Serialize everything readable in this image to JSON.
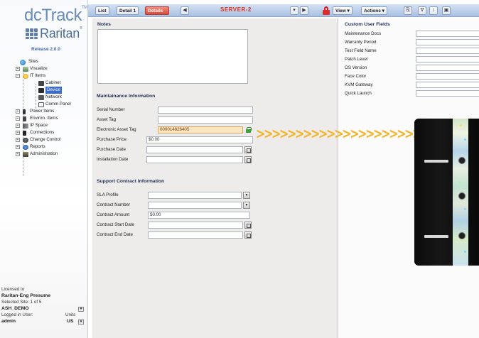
{
  "sidebar": {
    "brand": "dcTrack",
    "brand_mark": "TM",
    "vendor": "Raritan",
    "vendor_mark": "®",
    "release": "Release 2.0.0",
    "tree": [
      {
        "label": "Sites",
        "icon": "globe-icon"
      },
      {
        "label": "Visualize",
        "icon": "visualize-icon"
      },
      {
        "label": "IT Items",
        "icon": "it-items-icon"
      },
      {
        "label": "Cabinet",
        "icon": "cabinet-icon"
      },
      {
        "label": "Device",
        "icon": "device-icon"
      },
      {
        "label": "Network",
        "icon": "network-icon"
      },
      {
        "label": "Comm Panel",
        "icon": "comm-panel-icon"
      },
      {
        "label": "Power Items",
        "icon": "power-icon"
      },
      {
        "label": "Environ. Items",
        "icon": "environ-icon"
      },
      {
        "label": "IP Space",
        "icon": "ip-space-icon"
      },
      {
        "label": "Connections",
        "icon": "connections-icon"
      },
      {
        "label": "Change Control",
        "icon": "change-control-icon"
      },
      {
        "label": "Reports",
        "icon": "reports-icon"
      },
      {
        "label": "Administration",
        "icon": "administration-icon"
      }
    ],
    "status": {
      "licensed_label": "Licensed to",
      "licensee": "Raritan-Eng Presume",
      "selected_site": "Selected Site: 1 of 5",
      "site_name": "ASH_DEMO",
      "logged_in_label": "Logged in User:",
      "units_label": "Units",
      "user": "admin",
      "units": "US"
    }
  },
  "toolbar": {
    "list_label": "List",
    "detail_label": "Detail 1",
    "active_label": "Details",
    "title": "SERVER-2",
    "view_label": "View",
    "actions_label": "Actions"
  },
  "notes": {
    "title": "Notes",
    "value": ""
  },
  "maintenance": {
    "title": "Maintainance Information",
    "fields": [
      {
        "label": "Serial Number",
        "value": ""
      },
      {
        "label": "Asset Tag",
        "value": ""
      },
      {
        "label": "Electronic Asset Tag",
        "value": "000014826405"
      },
      {
        "label": "Purchase Price",
        "value": "$0.00"
      },
      {
        "label": "Purchase Date",
        "value": ""
      },
      {
        "label": "Installation Date",
        "value": ""
      }
    ]
  },
  "support": {
    "title": "Support Contract Information",
    "fields": [
      {
        "label": "SLA Profile",
        "value": ""
      },
      {
        "label": "Contract Number",
        "value": ""
      },
      {
        "label": "Contract Amount",
        "value": "$0.00"
      },
      {
        "label": "Contract Start Date",
        "value": ""
      },
      {
        "label": "Contract End Date",
        "value": ""
      }
    ]
  },
  "custom_fields": {
    "title": "Custom User Fields",
    "labels": [
      "Maintenance Docs",
      "Warranty Period",
      "Test Field Name",
      "Patch Level",
      "OS Version",
      "Face Color",
      "KVM Gateway",
      "Quick Launch"
    ]
  },
  "colors": {
    "accent": "#3b6cc7",
    "alert": "#e03020",
    "arrow": "#f5b52a"
  }
}
